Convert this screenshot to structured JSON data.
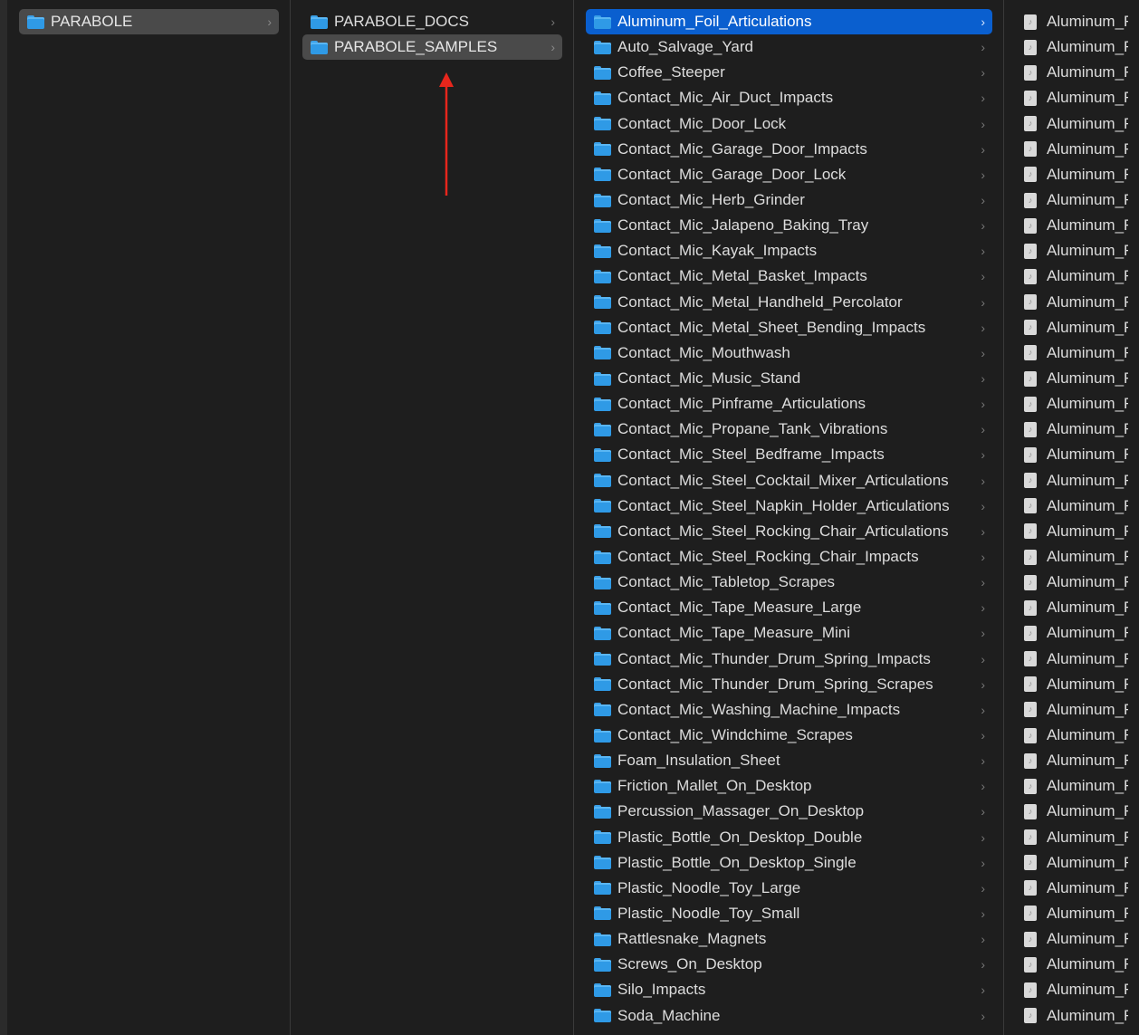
{
  "column1": {
    "items": [
      {
        "label": "PARABOLE",
        "type": "folder",
        "state": "selected-inactive"
      }
    ]
  },
  "column2": {
    "items": [
      {
        "label": "PARABOLE_DOCS",
        "type": "folder",
        "state": ""
      },
      {
        "label": "PARABOLE_SAMPLES",
        "type": "folder",
        "state": "selected-inactive"
      }
    ]
  },
  "column3": {
    "items": [
      {
        "label": "Aluminum_Foil_Articulations",
        "type": "folder",
        "state": "selected-active"
      },
      {
        "label": "Auto_Salvage_Yard",
        "type": "folder",
        "state": ""
      },
      {
        "label": "Coffee_Steeper",
        "type": "folder",
        "state": ""
      },
      {
        "label": "Contact_Mic_Air_Duct_Impacts",
        "type": "folder",
        "state": ""
      },
      {
        "label": "Contact_Mic_Door_Lock",
        "type": "folder",
        "state": ""
      },
      {
        "label": "Contact_Mic_Garage_Door_Impacts",
        "type": "folder",
        "state": ""
      },
      {
        "label": "Contact_Mic_Garage_Door_Lock",
        "type": "folder",
        "state": ""
      },
      {
        "label": "Contact_Mic_Herb_Grinder",
        "type": "folder",
        "state": ""
      },
      {
        "label": "Contact_Mic_Jalapeno_Baking_Tray",
        "type": "folder",
        "state": ""
      },
      {
        "label": "Contact_Mic_Kayak_Impacts",
        "type": "folder",
        "state": ""
      },
      {
        "label": "Contact_Mic_Metal_Basket_Impacts",
        "type": "folder",
        "state": ""
      },
      {
        "label": "Contact_Mic_Metal_Handheld_Percolator",
        "type": "folder",
        "state": ""
      },
      {
        "label": "Contact_Mic_Metal_Sheet_Bending_Impacts",
        "type": "folder",
        "state": ""
      },
      {
        "label": "Contact_Mic_Mouthwash",
        "type": "folder",
        "state": ""
      },
      {
        "label": "Contact_Mic_Music_Stand",
        "type": "folder",
        "state": ""
      },
      {
        "label": "Contact_Mic_Pinframe_Articulations",
        "type": "folder",
        "state": ""
      },
      {
        "label": "Contact_Mic_Propane_Tank_Vibrations",
        "type": "folder",
        "state": ""
      },
      {
        "label": "Contact_Mic_Steel_Bedframe_Impacts",
        "type": "folder",
        "state": ""
      },
      {
        "label": "Contact_Mic_Steel_Cocktail_Mixer_Articulations",
        "type": "folder",
        "state": ""
      },
      {
        "label": "Contact_Mic_Steel_Napkin_Holder_Articulations",
        "type": "folder",
        "state": ""
      },
      {
        "label": "Contact_Mic_Steel_Rocking_Chair_Articulations",
        "type": "folder",
        "state": ""
      },
      {
        "label": "Contact_Mic_Steel_Rocking_Chair_Impacts",
        "type": "folder",
        "state": ""
      },
      {
        "label": "Contact_Mic_Tabletop_Scrapes",
        "type": "folder",
        "state": ""
      },
      {
        "label": "Contact_Mic_Tape_Measure_Large",
        "type": "folder",
        "state": ""
      },
      {
        "label": "Contact_Mic_Tape_Measure_Mini",
        "type": "folder",
        "state": ""
      },
      {
        "label": "Contact_Mic_Thunder_Drum_Spring_Impacts",
        "type": "folder",
        "state": ""
      },
      {
        "label": "Contact_Mic_Thunder_Drum_Spring_Scrapes",
        "type": "folder",
        "state": ""
      },
      {
        "label": "Contact_Mic_Washing_Machine_Impacts",
        "type": "folder",
        "state": ""
      },
      {
        "label": "Contact_Mic_Windchime_Scrapes",
        "type": "folder",
        "state": ""
      },
      {
        "label": "Foam_Insulation_Sheet",
        "type": "folder",
        "state": ""
      },
      {
        "label": "Friction_Mallet_On_Desktop",
        "type": "folder",
        "state": ""
      },
      {
        "label": "Percussion_Massager_On_Desktop",
        "type": "folder",
        "state": ""
      },
      {
        "label": "Plastic_Bottle_On_Desktop_Double",
        "type": "folder",
        "state": ""
      },
      {
        "label": "Plastic_Bottle_On_Desktop_Single",
        "type": "folder",
        "state": ""
      },
      {
        "label": "Plastic_Noodle_Toy_Large",
        "type": "folder",
        "state": ""
      },
      {
        "label": "Plastic_Noodle_Toy_Small",
        "type": "folder",
        "state": ""
      },
      {
        "label": "Rattlesnake_Magnets",
        "type": "folder",
        "state": ""
      },
      {
        "label": "Screws_On_Desktop",
        "type": "folder",
        "state": ""
      },
      {
        "label": "Silo_Impacts",
        "type": "folder",
        "state": ""
      },
      {
        "label": "Soda_Machine",
        "type": "folder",
        "state": ""
      }
    ]
  },
  "column4": {
    "item_label": "Aluminum_Fo",
    "item_type": "audio-file",
    "visible_rows": 40
  },
  "colors": {
    "background": "#1e1e1e",
    "selection_active": "#0a5fcf",
    "selection_inactive": "#4a4a4a",
    "folder_blue": "#2f9ae6",
    "text": "#dddddd",
    "annotation_arrow": "#e8261c"
  },
  "icons": {
    "folder": "folder-icon",
    "audio_file": "audio-file-icon",
    "disclosure": "chevron-right-icon"
  }
}
